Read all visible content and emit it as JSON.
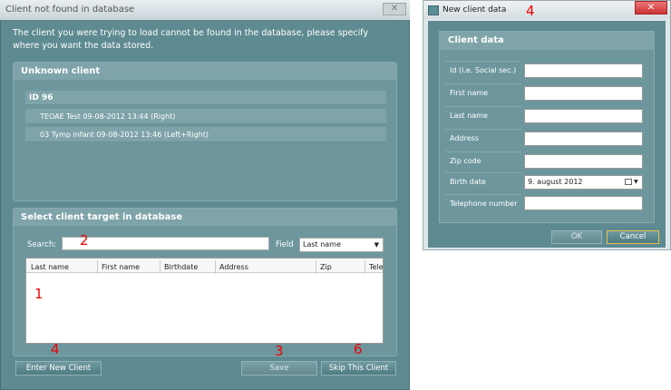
{
  "dialog1": {
    "title": "Client not found in database",
    "close_label": "✕",
    "intro": "The client you were trying to load cannot be found in the database, please specify where you want the data stored.",
    "unknown_client": {
      "header": "Unknown client",
      "id_label": "ID 96",
      "items": [
        "TEOAE Test 09-08-2012 13:44 (Right)",
        "03 Tymp infant 09-08-2012 13:46 (Left+Right)"
      ]
    },
    "target": {
      "header": "Select client target in database",
      "search_label": "Search:",
      "search_value": "",
      "field_label": "Field",
      "field_value": "Last name",
      "columns": [
        "Last name",
        "First name",
        "Birthdate",
        "Address",
        "Zip",
        "Tele"
      ]
    },
    "buttons": {
      "enter_new": "Enter New Client",
      "save": "Save",
      "skip": "Skip This Client"
    }
  },
  "dialog2": {
    "title": "New client data",
    "close_label": "✕",
    "panel_header": "Client data",
    "fields": [
      {
        "label": "Id (i.e. Social sec.)",
        "value": ""
      },
      {
        "label": "First name",
        "value": ""
      },
      {
        "label": "Last name",
        "value": ""
      },
      {
        "label": "Address",
        "value": ""
      },
      {
        "label": "Zip code",
        "value": ""
      },
      {
        "label": "Birth date",
        "value": "9.   august   2012"
      },
      {
        "label": "Telephone number",
        "value": ""
      }
    ],
    "buttons": {
      "ok": "OK",
      "cancel": "Cancel"
    }
  },
  "annotations": {
    "n1": "1",
    "n2": "2",
    "n3": "3",
    "n4a": "4",
    "n4b": "4",
    "n6": "6"
  }
}
